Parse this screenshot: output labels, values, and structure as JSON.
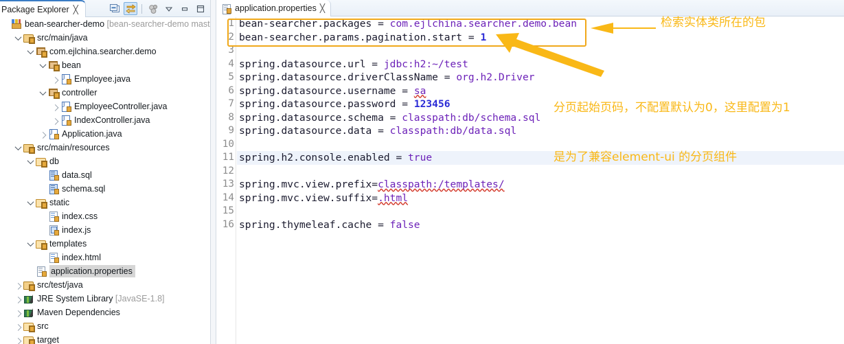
{
  "explorer": {
    "tab_label": "Package Explorer",
    "tab_close": "╳",
    "toolbar": [
      {
        "name": "collapse-all-icon",
        "title": "Collapse All"
      },
      {
        "name": "link-with-editor-icon",
        "title": "Link with Editor"
      },
      {
        "name": "focus-on-active-task-icon",
        "title": "Focus on Active Task"
      },
      {
        "name": "view-menu-icon",
        "title": "View Menu"
      },
      {
        "name": "minimize-icon",
        "title": "Minimize"
      },
      {
        "name": "maximize-icon",
        "title": "Maximize"
      }
    ],
    "tree": [
      {
        "indent": 0,
        "twisty": "none",
        "icon": "project",
        "label": "bean-searcher-demo",
        "suffix": " [bean-searcher-demo mast",
        "selected": false
      },
      {
        "indent": 1,
        "twisty": "down",
        "icon": "srcfolder",
        "label": "src/main/java",
        "suffix": "",
        "selected": false
      },
      {
        "indent": 2,
        "twisty": "down",
        "icon": "package",
        "label": "com.ejlchina.searcher.demo",
        "suffix": "",
        "selected": false
      },
      {
        "indent": 3,
        "twisty": "down",
        "icon": "package",
        "label": "bean",
        "suffix": "",
        "selected": false
      },
      {
        "indent": 4,
        "twisty": "right",
        "icon": "java",
        "label": "Employee.java",
        "suffix": "",
        "selected": false
      },
      {
        "indent": 3,
        "twisty": "down",
        "icon": "package",
        "label": "controller",
        "suffix": "",
        "selected": false
      },
      {
        "indent": 4,
        "twisty": "right",
        "icon": "java",
        "label": "EmployeeController.java",
        "suffix": "",
        "selected": false
      },
      {
        "indent": 4,
        "twisty": "right",
        "icon": "java",
        "label": "IndexController.java",
        "suffix": "",
        "selected": false
      },
      {
        "indent": 3,
        "twisty": "right",
        "icon": "java",
        "label": "Application.java",
        "suffix": "",
        "selected": false
      },
      {
        "indent": 1,
        "twisty": "down",
        "icon": "srcfolder",
        "label": "src/main/resources",
        "suffix": "",
        "selected": false
      },
      {
        "indent": 2,
        "twisty": "down",
        "icon": "folder",
        "label": "db",
        "suffix": "",
        "selected": false
      },
      {
        "indent": 3,
        "twisty": "none",
        "icon": "sql",
        "label": "data.sql",
        "suffix": "",
        "selected": false
      },
      {
        "indent": 3,
        "twisty": "none",
        "icon": "sql",
        "label": "schema.sql",
        "suffix": "",
        "selected": false
      },
      {
        "indent": 2,
        "twisty": "down",
        "icon": "folder",
        "label": "static",
        "suffix": "",
        "selected": false
      },
      {
        "indent": 3,
        "twisty": "none",
        "icon": "css",
        "label": "index.css",
        "suffix": "",
        "selected": false
      },
      {
        "indent": 3,
        "twisty": "none",
        "icon": "js",
        "label": "index.js",
        "suffix": "",
        "selected": false
      },
      {
        "indent": 2,
        "twisty": "down",
        "icon": "folder",
        "label": "templates",
        "suffix": "",
        "selected": false
      },
      {
        "indent": 3,
        "twisty": "none",
        "icon": "html",
        "label": "index.html",
        "suffix": "",
        "selected": false
      },
      {
        "indent": 2,
        "twisty": "none",
        "icon": "props",
        "label": "application.properties",
        "suffix": "",
        "selected": true
      },
      {
        "indent": 1,
        "twisty": "right",
        "icon": "srcfolder",
        "label": "src/test/java",
        "suffix": "",
        "selected": false
      },
      {
        "indent": 1,
        "twisty": "right",
        "icon": "lib",
        "label": "JRE System Library",
        "suffix": " [JavaSE-1.8]",
        "selected": false
      },
      {
        "indent": 1,
        "twisty": "right",
        "icon": "lib",
        "label": "Maven Dependencies",
        "suffix": "",
        "selected": false
      },
      {
        "indent": 1,
        "twisty": "right",
        "icon": "folder",
        "label": "src",
        "suffix": "",
        "selected": false
      },
      {
        "indent": 1,
        "twisty": "right",
        "icon": "folder",
        "label": "target",
        "suffix": "",
        "selected": false
      }
    ]
  },
  "editor": {
    "tab_label": "application.properties",
    "tab_close": "╳",
    "current_line": 11,
    "lines": [
      {
        "n": 1,
        "key": "bean-searcher.packages = ",
        "val": "com.ejlchina.searcher.demo.bean",
        "val_kind": "val"
      },
      {
        "n": 2,
        "key": "bean-searcher.params.pagination.start = ",
        "val": "1",
        "val_kind": "num"
      },
      {
        "n": 3,
        "key": "",
        "val": "",
        "val_kind": "val"
      },
      {
        "n": 4,
        "key": "spring.datasource.url = ",
        "val": "jdbc:h2:~/test",
        "val_kind": "val"
      },
      {
        "n": 5,
        "key": "spring.datasource.driverClassName = ",
        "val": "org.h2.Driver",
        "val_kind": "val"
      },
      {
        "n": 6,
        "key": "spring.datasource.username = ",
        "val": "sa",
        "val_kind": "val",
        "squiggle": true
      },
      {
        "n": 7,
        "key": "spring.datasource.password = ",
        "val": "123456",
        "val_kind": "num"
      },
      {
        "n": 8,
        "key": "spring.datasource.schema = ",
        "val": "classpath:db/schema.sql",
        "val_kind": "val"
      },
      {
        "n": 9,
        "key": "spring.datasource.data = ",
        "val": "classpath:db/data.sql",
        "val_kind": "val"
      },
      {
        "n": 10,
        "key": "",
        "val": "",
        "val_kind": "val"
      },
      {
        "n": 11,
        "key": "spring.h2.console.enabled = ",
        "val": "true",
        "val_kind": "val"
      },
      {
        "n": 12,
        "key": "",
        "val": "",
        "val_kind": "val"
      },
      {
        "n": 13,
        "key": "spring.mvc.view.prefix=",
        "val": "classpath:/templates/",
        "val_kind": "val",
        "squiggle": true
      },
      {
        "n": 14,
        "key": "spring.mvc.view.suffix=",
        "val": ".html",
        "val_kind": "val",
        "squiggle": true
      },
      {
        "n": 15,
        "key": "",
        "val": "",
        "val_kind": "val"
      },
      {
        "n": 16,
        "key": "spring.thymeleaf.cache = ",
        "val": "false",
        "val_kind": "val"
      }
    ]
  },
  "annotations": {
    "color": "#f9b817",
    "highlight_box_color": "#f0a81a",
    "note1": "检索实体类所在的包",
    "note2_line1": "分页起始页码，不配置默认为0，这里配置为1",
    "note2_line2": "是为了兼容element-ui 的分页组件"
  }
}
